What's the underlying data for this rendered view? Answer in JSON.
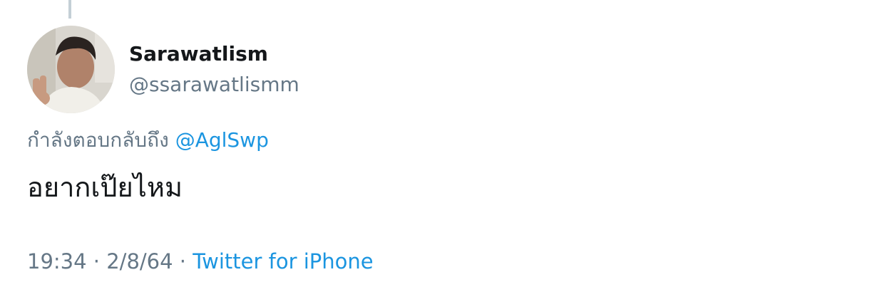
{
  "tweet": {
    "author": {
      "display_name": "Sarawatlism",
      "handle": "@ssarawatlismm"
    },
    "reply_context": {
      "prefix": "กำลังตอบกลับถึง",
      "mention": "@AglSwp"
    },
    "text": "อยากเป๊ยไหม",
    "meta": {
      "time": "19:34",
      "separator": "·",
      "date": "2/8/64",
      "source": "Twitter for iPhone"
    }
  },
  "colors": {
    "primary_text": "#14171a",
    "secondary_text": "#657786",
    "link": "#1b95e0",
    "thread_line": "#c4cfd6"
  }
}
